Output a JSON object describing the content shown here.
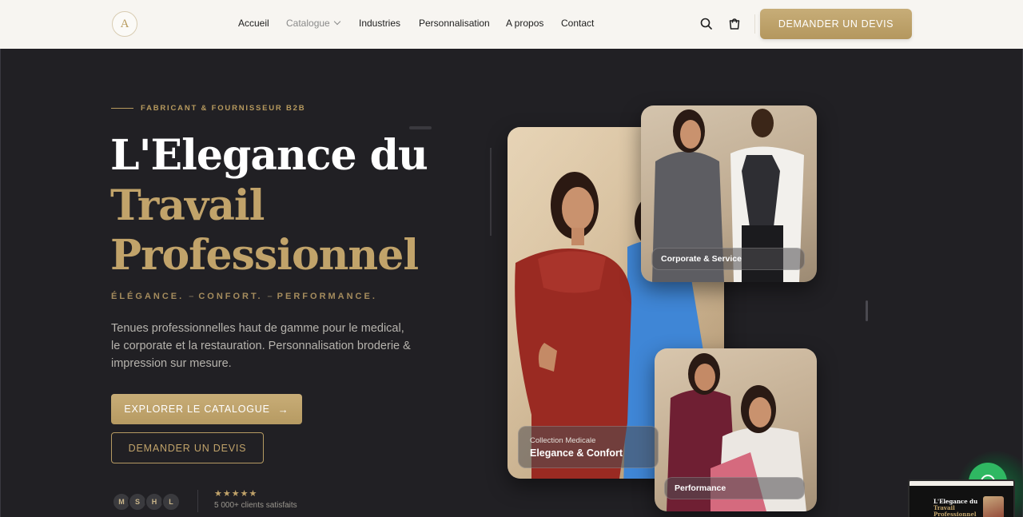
{
  "header": {
    "logo_letter": "A",
    "nav": [
      {
        "label": "Accueil"
      },
      {
        "label": "Catalogue"
      },
      {
        "label": "Industries"
      },
      {
        "label": "Personnalisation"
      },
      {
        "label": "A propos"
      },
      {
        "label": "Contact"
      }
    ],
    "icons": [
      "search-icon",
      "cart-icon"
    ],
    "cta_label": "DEMANDER UN DEVIS"
  },
  "hero": {
    "eyebrow": "FABRICANT & FOURNISSEUR B2B",
    "title_line1": "L'Elegance du",
    "title_line2": "Travail",
    "title_line3": "Professionnel",
    "values": [
      "ÉLÉGANCE.",
      "CONFORT.",
      "PERFORMANCE."
    ],
    "value_separator": "–",
    "description": "Tenues professionnelles haut de gamme pour le medical, le corporate et la restauration. Personnalisation broderie & impression sur mesure.",
    "primary_cta": "EXPLORER LE CATALOGUE",
    "primary_cta_arrow": "→",
    "secondary_cta": "DEMANDER UN DEVIS",
    "avatars": [
      "M",
      "S",
      "H",
      "L"
    ],
    "stars": "★★★★★",
    "rating": 5,
    "clients_text": "5 000+ clients satisfaits"
  },
  "cards": {
    "main_small": "Collection Medicale",
    "main_big": "Elegance & Confort",
    "top_right": "Corporate & Service",
    "bottom_right": "Performance"
  },
  "preview": {
    "line1": "L'Elegance du",
    "line2": "Travail",
    "line3": "Professionnel"
  },
  "colors": {
    "gold": "#c1a36a",
    "hero_bg": "#212024",
    "header_bg": "#f7f5f1",
    "chat_green": "#2fb862"
  }
}
